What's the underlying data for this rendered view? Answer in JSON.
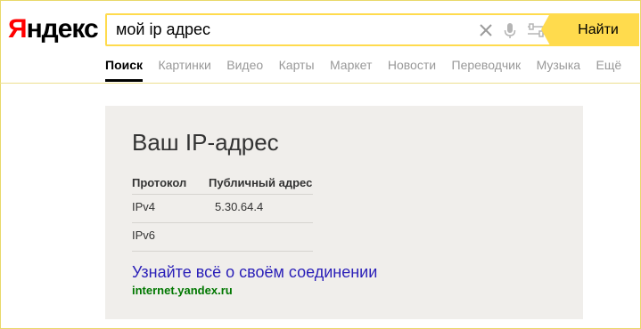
{
  "logo": {
    "first_letter": "Я",
    "rest": "ндекс"
  },
  "search": {
    "value": "мой ip адрес",
    "button_label": "Найти",
    "icons": [
      "close-icon",
      "microphone-icon",
      "settings-sliders-icon"
    ]
  },
  "tabs": [
    {
      "label": "Поиск",
      "active": true
    },
    {
      "label": "Картинки"
    },
    {
      "label": "Видео"
    },
    {
      "label": "Карты"
    },
    {
      "label": "Маркет"
    },
    {
      "label": "Новости"
    },
    {
      "label": "Переводчик"
    },
    {
      "label": "Музыка"
    },
    {
      "label": "Ещё"
    }
  ],
  "ip_card": {
    "title": "Ваш IP-адрес",
    "columns": [
      "Протокол",
      "Публичный адрес"
    ],
    "rows": [
      {
        "protocol": "IPv4",
        "address": "5.30.64.4"
      },
      {
        "protocol": "IPv6",
        "address": ""
      }
    ],
    "link_text": "Узнайте всё о своём соединении",
    "domain": "internet.yandex.ru"
  },
  "colors": {
    "accent_yellow": "#ffdb4d",
    "logo_red": "#ff0000",
    "card_bg": "#f0eeeb",
    "link_blue": "#2a1fb8",
    "domain_green": "#007700"
  }
}
